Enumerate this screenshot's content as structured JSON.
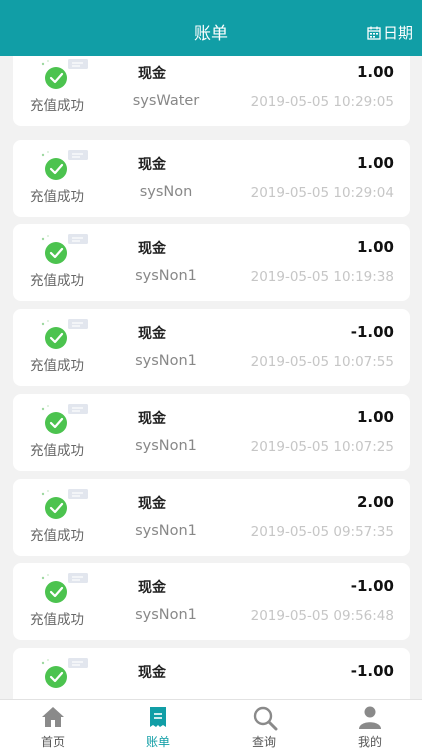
{
  "header": {
    "title": "账单",
    "date_label": "日期",
    "date_icon": "calendar-icon"
  },
  "records": [
    {
      "status": "充值成功",
      "type": "现金",
      "source": "sysWater",
      "amount": "1.00",
      "time": "2019-05-05 10:29:05"
    },
    {
      "status": "充值成功",
      "type": "现金",
      "source": "sysNon",
      "amount": "1.00",
      "time": "2019-05-05 10:29:04"
    },
    {
      "status": "充值成功",
      "type": "现金",
      "source": "sysNon1",
      "amount": "1.00",
      "time": "2019-05-05 10:19:38"
    },
    {
      "status": "充值成功",
      "type": "现金",
      "source": "sysNon1",
      "amount": "-1.00",
      "time": "2019-05-05 10:07:55"
    },
    {
      "status": "充值成功",
      "type": "现金",
      "source": "sysNon1",
      "amount": "1.00",
      "time": "2019-05-05 10:07:25"
    },
    {
      "status": "充值成功",
      "type": "现金",
      "source": "sysNon1",
      "amount": "2.00",
      "time": "2019-05-05 09:57:35"
    },
    {
      "status": "充值成功",
      "type": "现金",
      "source": "sysNon1",
      "amount": "-1.00",
      "time": "2019-05-05 09:56:48"
    },
    {
      "status": "",
      "type": "现金",
      "source": "",
      "amount": "-1.00",
      "time": ""
    }
  ],
  "tabbar": [
    {
      "label": "首页",
      "icon": "home-icon",
      "active": false
    },
    {
      "label": "账单",
      "icon": "bill-icon",
      "active": true
    },
    {
      "label": "查询",
      "icon": "search-icon",
      "active": false
    },
    {
      "label": "我的",
      "icon": "user-icon",
      "active": false
    }
  ],
  "colors": {
    "primary": "#119ea6",
    "success": "#4cc34f",
    "background": "#f2f2f2"
  }
}
